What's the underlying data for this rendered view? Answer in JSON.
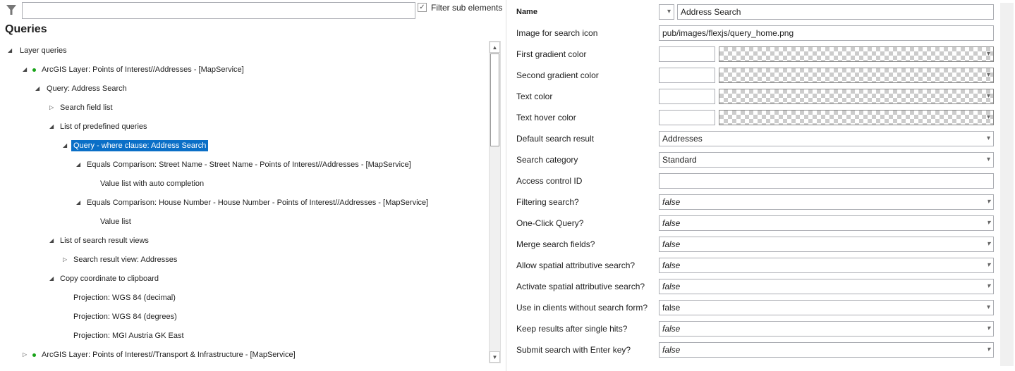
{
  "filter": {
    "value": "",
    "checkbox_label": "Filter sub elements",
    "checked": true
  },
  "title": "Queries",
  "tree": [
    {
      "label": "Layer queries",
      "level": 0,
      "arrow": "expanded"
    },
    {
      "label": "ArcGIS Layer: Points of Interest//Addresses - [MapService]",
      "level": 1,
      "arrow": "expanded",
      "dot": true
    },
    {
      "label": "Query: Address Search",
      "level": 2,
      "arrow": "expanded"
    },
    {
      "label": "Search field list",
      "level": 3,
      "arrow": "collapsed"
    },
    {
      "label": "List of predefined queries",
      "level": 3,
      "arrow": "expanded"
    },
    {
      "label": "Query - where clause: Address Search",
      "level": 4,
      "arrow": "expanded",
      "selected": true
    },
    {
      "label": "Equals Comparison: Street Name - Street Name - Points of Interest//Addresses - [MapService]",
      "level": 5,
      "arrow": "expanded"
    },
    {
      "label": "Value list with auto completion",
      "level": 6
    },
    {
      "label": "Equals Comparison: House Number - House Number - Points of Interest//Addresses - [MapService]",
      "level": 5,
      "arrow": "expanded"
    },
    {
      "label": "Value list",
      "level": 6
    },
    {
      "label": "List of search result views",
      "level": 3,
      "arrow": "expanded"
    },
    {
      "label": "Search result view: Addresses",
      "level": 4,
      "arrow": "collapsed"
    },
    {
      "label": "Copy coordinate to clipboard",
      "level": 3,
      "arrow": "expanded"
    },
    {
      "label": "Projection: WGS 84 (decimal)",
      "level": 4
    },
    {
      "label": "Projection: WGS 84 (degrees)",
      "level": 4
    },
    {
      "label": "Projection: MGI Austria GK East",
      "level": 4
    },
    {
      "label": "ArcGIS Layer: Points of Interest//Transport & Infrastructure - [MapService]",
      "level": 1,
      "arrow": "collapsed",
      "dot": true
    }
  ],
  "props": [
    {
      "label": "Name",
      "type": "name",
      "value": "Address Search",
      "bold": true
    },
    {
      "label": "Image for search icon",
      "type": "text",
      "value": "pub/images/flexjs/query_home.png"
    },
    {
      "label": "First gradient color",
      "type": "color",
      "value": ""
    },
    {
      "label": "Second gradient color",
      "type": "color",
      "value": ""
    },
    {
      "label": "Text color",
      "type": "color",
      "value": ""
    },
    {
      "label": "Text hover color",
      "type": "color",
      "value": ""
    },
    {
      "label": "Default search result",
      "type": "select",
      "value": "Addresses"
    },
    {
      "label": "Search category",
      "type": "select",
      "value": "Standard"
    },
    {
      "label": "Access control ID",
      "type": "text",
      "value": ""
    },
    {
      "label": "Filtering search?",
      "type": "select",
      "value": "false",
      "italic": true
    },
    {
      "label": "One-Click Query?",
      "type": "select",
      "value": "false",
      "italic": true
    },
    {
      "label": "Merge search fields?",
      "type": "select",
      "value": "false",
      "italic": true
    },
    {
      "label": "Allow spatial attributive search?",
      "type": "select",
      "value": "false",
      "italic": true
    },
    {
      "label": "Activate spatial attributive search?",
      "type": "select",
      "value": "false",
      "italic": true
    },
    {
      "label": "Use in clients without search form?",
      "type": "select",
      "value": "false",
      "italic": false
    },
    {
      "label": "Keep results after single hits?",
      "type": "select",
      "value": "false",
      "italic": true
    },
    {
      "label": "Submit search with Enter key?",
      "type": "select",
      "value": "false",
      "italic": true
    }
  ],
  "colors": {
    "selection": "#0a6fc7",
    "dot": "#19a319"
  }
}
